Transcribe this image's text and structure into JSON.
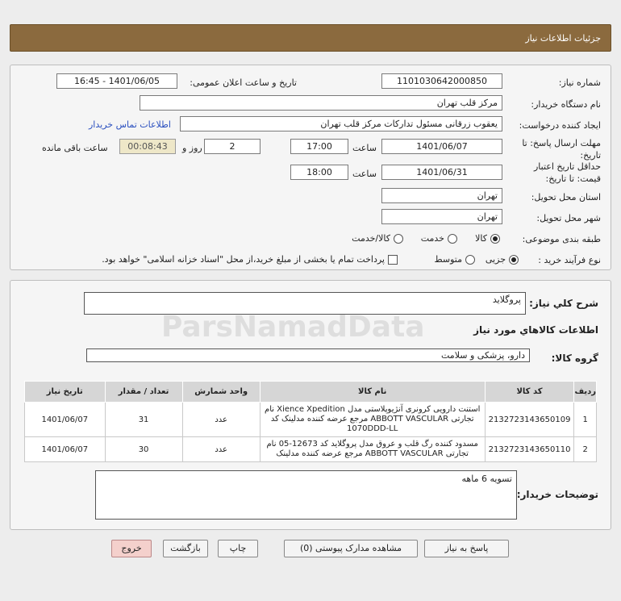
{
  "header": {
    "title": "جزئیات اطلاعات نیاز"
  },
  "form": {
    "need_number_label": "شماره نیاز:",
    "need_number": "1101030642000850",
    "announce_label": "تاریخ و ساعت اعلان عمومی:",
    "announce_value": "1401/06/05 - 16:45",
    "buyer_org_label": "نام دستگاه خریدار:",
    "buyer_org": "مرکز قلب تهران",
    "requester_label": "ایجاد کننده درخواست:",
    "requester": "یعقوب زرقانی مسئول تدارکات مرکز قلب تهران",
    "contact_link": "اطلاعات تماس خریدار",
    "deadline_label": "مهلت ارسال پاسخ: تا تاریخ:",
    "deadline_date": "1401/06/07",
    "time_label": "ساعت",
    "deadline_time": "17:00",
    "days_value": "2",
    "days_label": "روز و",
    "timer": "00:08:43",
    "remaining_label": "ساعت باقی مانده",
    "validity_label": "حداقل تاریخ اعتبار قیمت: تا تاریخ:",
    "validity_date": "1401/06/31",
    "validity_time": "18:00",
    "province_label": "استان محل تحویل:",
    "province": "تهران",
    "city_label": "شهر محل تحویل:",
    "city": "تهران",
    "category_label": "طبقه بندی موضوعی:",
    "category_options": [
      "کالا",
      "خدمت",
      "کالا/خدمت"
    ],
    "process_label": "نوع فرآیند خرید :",
    "process_options": [
      "جزیی",
      "متوسط"
    ],
    "treasury_note": "پرداخت تمام یا بخشی از مبلغ خرید،از محل \"اسناد خزانه اسلامی\" خواهد بود."
  },
  "summary": {
    "label": "شرح کلي نياز:",
    "value": "پروگلاید",
    "goods_info_title": "اطلاعات کالاهاي مورد نياز",
    "group_label": "گروه کالا:",
    "group_value": "دارو، پزشکی و سلامت"
  },
  "table": {
    "headers": [
      "ردیف",
      "کد کالا",
      "نام کالا",
      "واحد شمارش",
      "تعداد / مقدار",
      "تاریخ نیاز"
    ],
    "rows": [
      {
        "row": "1",
        "code": "2132723143650109",
        "name": "استنت دارویی کرونری آنژیوپلاستی مدل Xience Xpedition نام تجارتی ABBOTT VASCULAR مرجع عرضه کننده مدلینک کد 1070DDD-LL",
        "unit": "عدد",
        "qty": "31",
        "date": "1401/06/07"
      },
      {
        "row": "2",
        "code": "2132723143650110",
        "name": "مسدود کننده رگ قلب و عروق مدل پروگلاید کد 12673-05 نام تجارتی ABBOTT VASCULAR مرجع عرضه کننده مدلینک",
        "unit": "عدد",
        "qty": "30",
        "date": "1401/06/07"
      }
    ]
  },
  "notes": {
    "label": "توضیحات خریدار:",
    "value": "تسویه 6 ماهه"
  },
  "buttons": {
    "reply": "پاسخ به نیاز",
    "attachments": "مشاهده مدارک پیوستی (0)",
    "print": "چاپ",
    "back": "بازگشت",
    "exit": "خروج"
  },
  "watermark": "ParsNamadData"
}
